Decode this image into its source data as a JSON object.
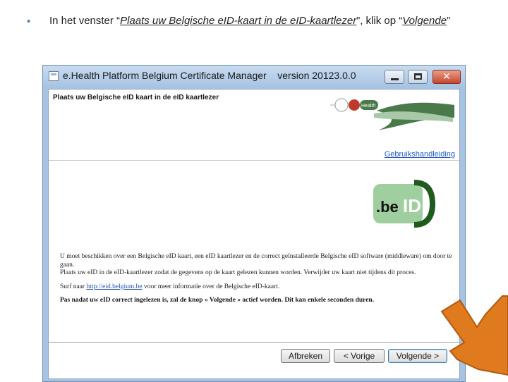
{
  "slide": {
    "bullet": "•",
    "instruction_prefix": "In het venster “",
    "instruction_window_name": "Plaats uw Belgische eID-kaart in de eID-kaartlezer",
    "instruction_mid": "”, klik op “",
    "instruction_button_name": "Volgende",
    "instruction_suffix": "”"
  },
  "window": {
    "title": "e.Health Platform Belgium Certificate Manager    version 20123.0.0",
    "close_glyph": "✕"
  },
  "dialog": {
    "header_title": "Plaats uw Belgische eID kaart in de eID kaartlezer",
    "ehealth_logo_text": "Health",
    "help_link": "Gebruikshandleiding",
    "beid_logo": {
      "dot_be": ".be",
      "id": "ID"
    },
    "info": {
      "line1": "U moet beschikken over een Belgische eID kaart, een eID kaartlezer en de correct geïnstalleerde Belgische eID software (middleware) om door te gaan.",
      "line2": "Plaats uw eID in de eID-kaartlezer zodat de gegevens op de kaart gelezen kunnen worden. Verwijder uw kaart niet tijdens dit proces.",
      "surf_prefix": "Surf naar ",
      "surf_link": "http://eid.belgium.be",
      "surf_suffix": " voor meer informatie over de Belgische eID-kaart.",
      "warning": "Pas nadat uw eID correct ingelezen is, zal de knop « Volgende » actief worden. Dit kan enkele seconden duren."
    },
    "buttons": {
      "cancel": "Afbreken",
      "previous": "< Vorige",
      "next": "Volgende >"
    }
  },
  "colors": {
    "arrow": "#e07a1e",
    "ehealth_green": "#4a7a4a",
    "beid_green": "#9fcf9f",
    "beid_dark": "#1f5a1f"
  }
}
